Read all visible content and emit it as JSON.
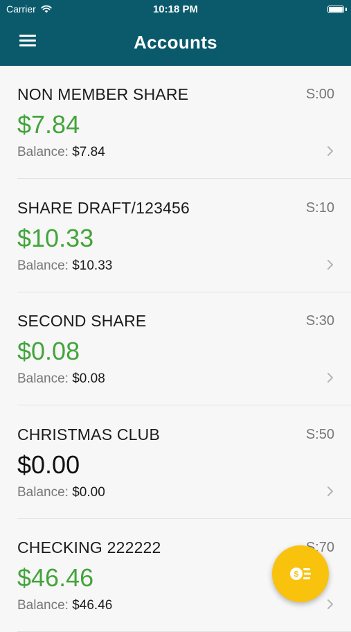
{
  "status_bar": {
    "carrier": "Carrier",
    "time": "10:18 PM",
    "battery_level": 1.0
  },
  "header": {
    "title": "Accounts"
  },
  "accounts": [
    {
      "name": "NON MEMBER SHARE",
      "code": "S:00",
      "amount": "$7.84",
      "balance_label": "Balance:",
      "balance": "$7.84"
    },
    {
      "name": "SHARE DRAFT/123456",
      "code": "S:10",
      "amount": "$10.33",
      "balance_label": "Balance:",
      "balance": "$10.33"
    },
    {
      "name": "SECOND SHARE",
      "code": "S:30",
      "amount": "$0.08",
      "balance_label": "Balance:",
      "balance": "$0.08"
    },
    {
      "name": "CHRISTMAS CLUB",
      "code": "S:50",
      "amount": "$0.00",
      "balance_label": "Balance:",
      "balance": "$0.00"
    },
    {
      "name": "CHECKING 222222",
      "code": "S:70",
      "amount": "$46.46",
      "balance_label": "Balance:",
      "balance": "$46.46"
    }
  ],
  "colors": {
    "header_bg": "#0a5a6b",
    "positive_amount": "#43a43c",
    "zero_amount": "#111111",
    "fab_bg": "#f9c20c"
  },
  "icons": {
    "menu": "hamburger-menu-icon",
    "chevron": "chevron-right-icon",
    "fab": "transfer-money-icon",
    "wifi": "wifi-icon",
    "battery": "battery-icon"
  }
}
